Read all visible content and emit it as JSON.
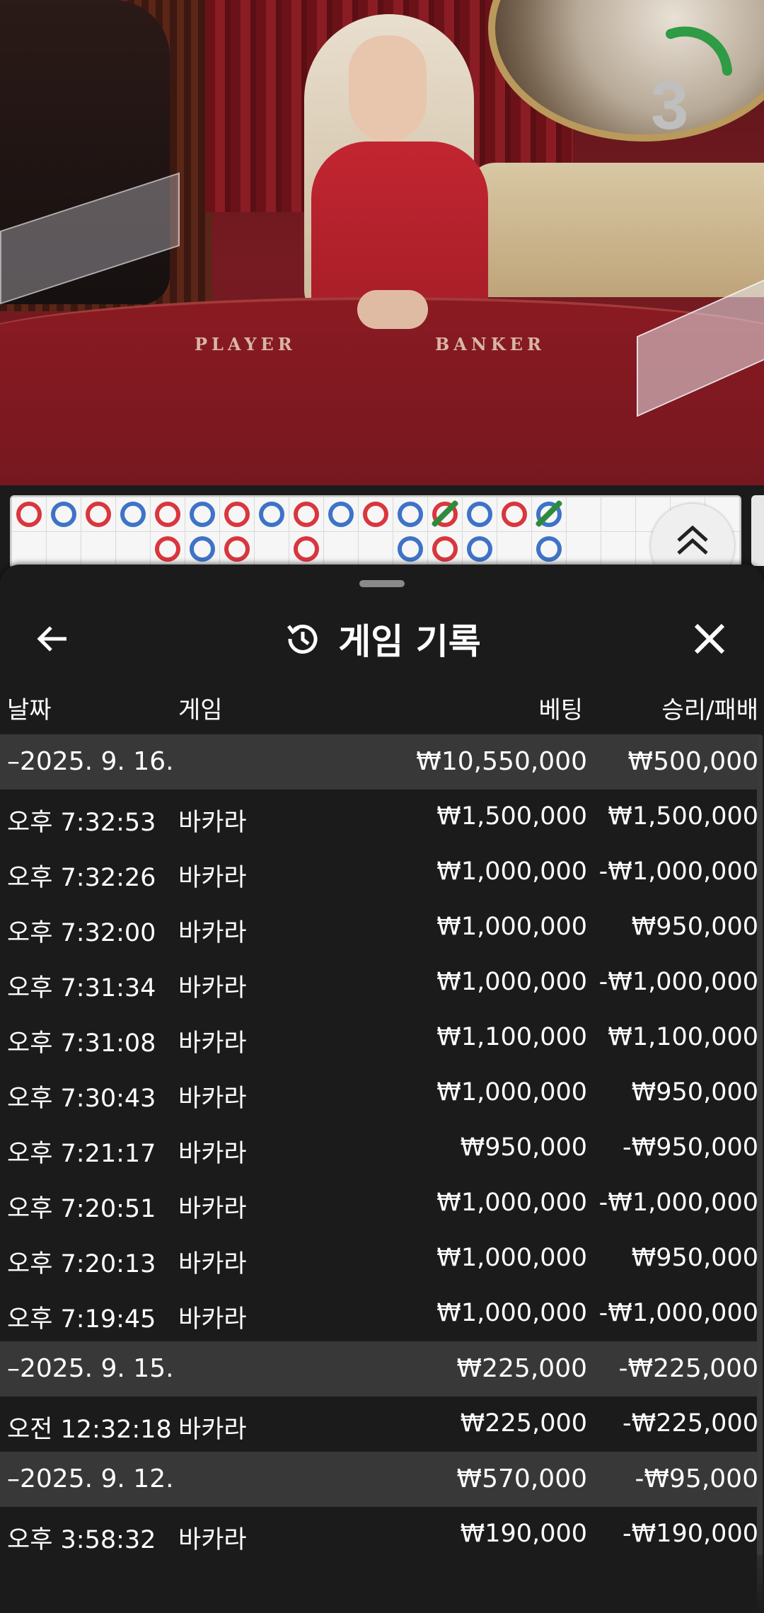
{
  "stream": {
    "timer_value": "3",
    "table_labels": [
      "PLAYER",
      "BANKER"
    ]
  },
  "roadmap": {
    "big_road": [
      {
        "col": 0,
        "row": 0,
        "result": "B"
      },
      {
        "col": 1,
        "row": 0,
        "result": "P"
      },
      {
        "col": 2,
        "row": 0,
        "result": "B"
      },
      {
        "col": 3,
        "row": 0,
        "result": "P"
      },
      {
        "col": 4,
        "row": 0,
        "result": "B"
      },
      {
        "col": 4,
        "row": 1,
        "result": "B"
      },
      {
        "col": 5,
        "row": 0,
        "result": "P"
      },
      {
        "col": 5,
        "row": 1,
        "result": "P"
      },
      {
        "col": 6,
        "row": 0,
        "result": "B"
      },
      {
        "col": 6,
        "row": 1,
        "result": "B"
      },
      {
        "col": 7,
        "row": 0,
        "result": "P"
      },
      {
        "col": 8,
        "row": 0,
        "result": "B"
      },
      {
        "col": 8,
        "row": 1,
        "result": "B"
      },
      {
        "col": 9,
        "row": 0,
        "result": "P"
      },
      {
        "col": 10,
        "row": 0,
        "result": "B"
      },
      {
        "col": 11,
        "row": 0,
        "result": "P"
      },
      {
        "col": 11,
        "row": 1,
        "result": "P"
      },
      {
        "col": 12,
        "row": 0,
        "result": "B",
        "tie": true
      },
      {
        "col": 12,
        "row": 1,
        "result": "B"
      },
      {
        "col": 13,
        "row": 0,
        "result": "P"
      },
      {
        "col": 13,
        "row": 1,
        "result": "P"
      },
      {
        "col": 14,
        "row": 0,
        "result": "B"
      },
      {
        "col": 15,
        "row": 0,
        "result": "P",
        "tie": true
      },
      {
        "col": 15,
        "row": 1,
        "result": "P"
      }
    ]
  },
  "sheet": {
    "title": "게임 기록",
    "columns": {
      "date": "날짜",
      "game": "게임",
      "bet": "베팅",
      "win_loss": "승리/패배"
    },
    "rows": [
      {
        "type": "group",
        "date": "–2025. 9. 16.",
        "game": "",
        "bet": "₩10,550,000",
        "win": "₩500,000"
      },
      {
        "type": "item",
        "date": "오후 7:32:53",
        "game": "바카라",
        "bet": "₩1,500,000",
        "win": "₩1,500,000"
      },
      {
        "type": "item",
        "date": "오후 7:32:26",
        "game": "바카라",
        "bet": "₩1,000,000",
        "win": "-₩1,000,000"
      },
      {
        "type": "item",
        "date": "오후 7:32:00",
        "game": "바카라",
        "bet": "₩1,000,000",
        "win": "₩950,000"
      },
      {
        "type": "item",
        "date": "오후 7:31:34",
        "game": "바카라",
        "bet": "₩1,000,000",
        "win": "-₩1,000,000"
      },
      {
        "type": "item",
        "date": "오후 7:31:08",
        "game": "바카라",
        "bet": "₩1,100,000",
        "win": "₩1,100,000"
      },
      {
        "type": "item",
        "date": "오후 7:30:43",
        "game": "바카라",
        "bet": "₩1,000,000",
        "win": "₩950,000"
      },
      {
        "type": "item",
        "date": "오후 7:21:17",
        "game": "바카라",
        "bet": "₩950,000",
        "win": "-₩950,000"
      },
      {
        "type": "item",
        "date": "오후 7:20:51",
        "game": "바카라",
        "bet": "₩1,000,000",
        "win": "-₩1,000,000"
      },
      {
        "type": "item",
        "date": "오후 7:20:13",
        "game": "바카라",
        "bet": "₩1,000,000",
        "win": "₩950,000"
      },
      {
        "type": "item",
        "date": "오후 7:19:45",
        "game": "바카라",
        "bet": "₩1,000,000",
        "win": "-₩1,000,000"
      },
      {
        "type": "group",
        "date": "–2025. 9. 15.",
        "game": "",
        "bet": "₩225,000",
        "win": "-₩225,000"
      },
      {
        "type": "item",
        "date": "오전 12:32:18",
        "game": "바카라",
        "bet": "₩225,000",
        "win": "-₩225,000"
      },
      {
        "type": "group",
        "date": "–2025. 9. 12.",
        "game": "",
        "bet": "₩570,000",
        "win": "-₩95,000"
      },
      {
        "type": "item",
        "date": "오후 3:58:32",
        "game": "바카라",
        "bet": "₩190,000",
        "win": "-₩190,000"
      }
    ]
  }
}
